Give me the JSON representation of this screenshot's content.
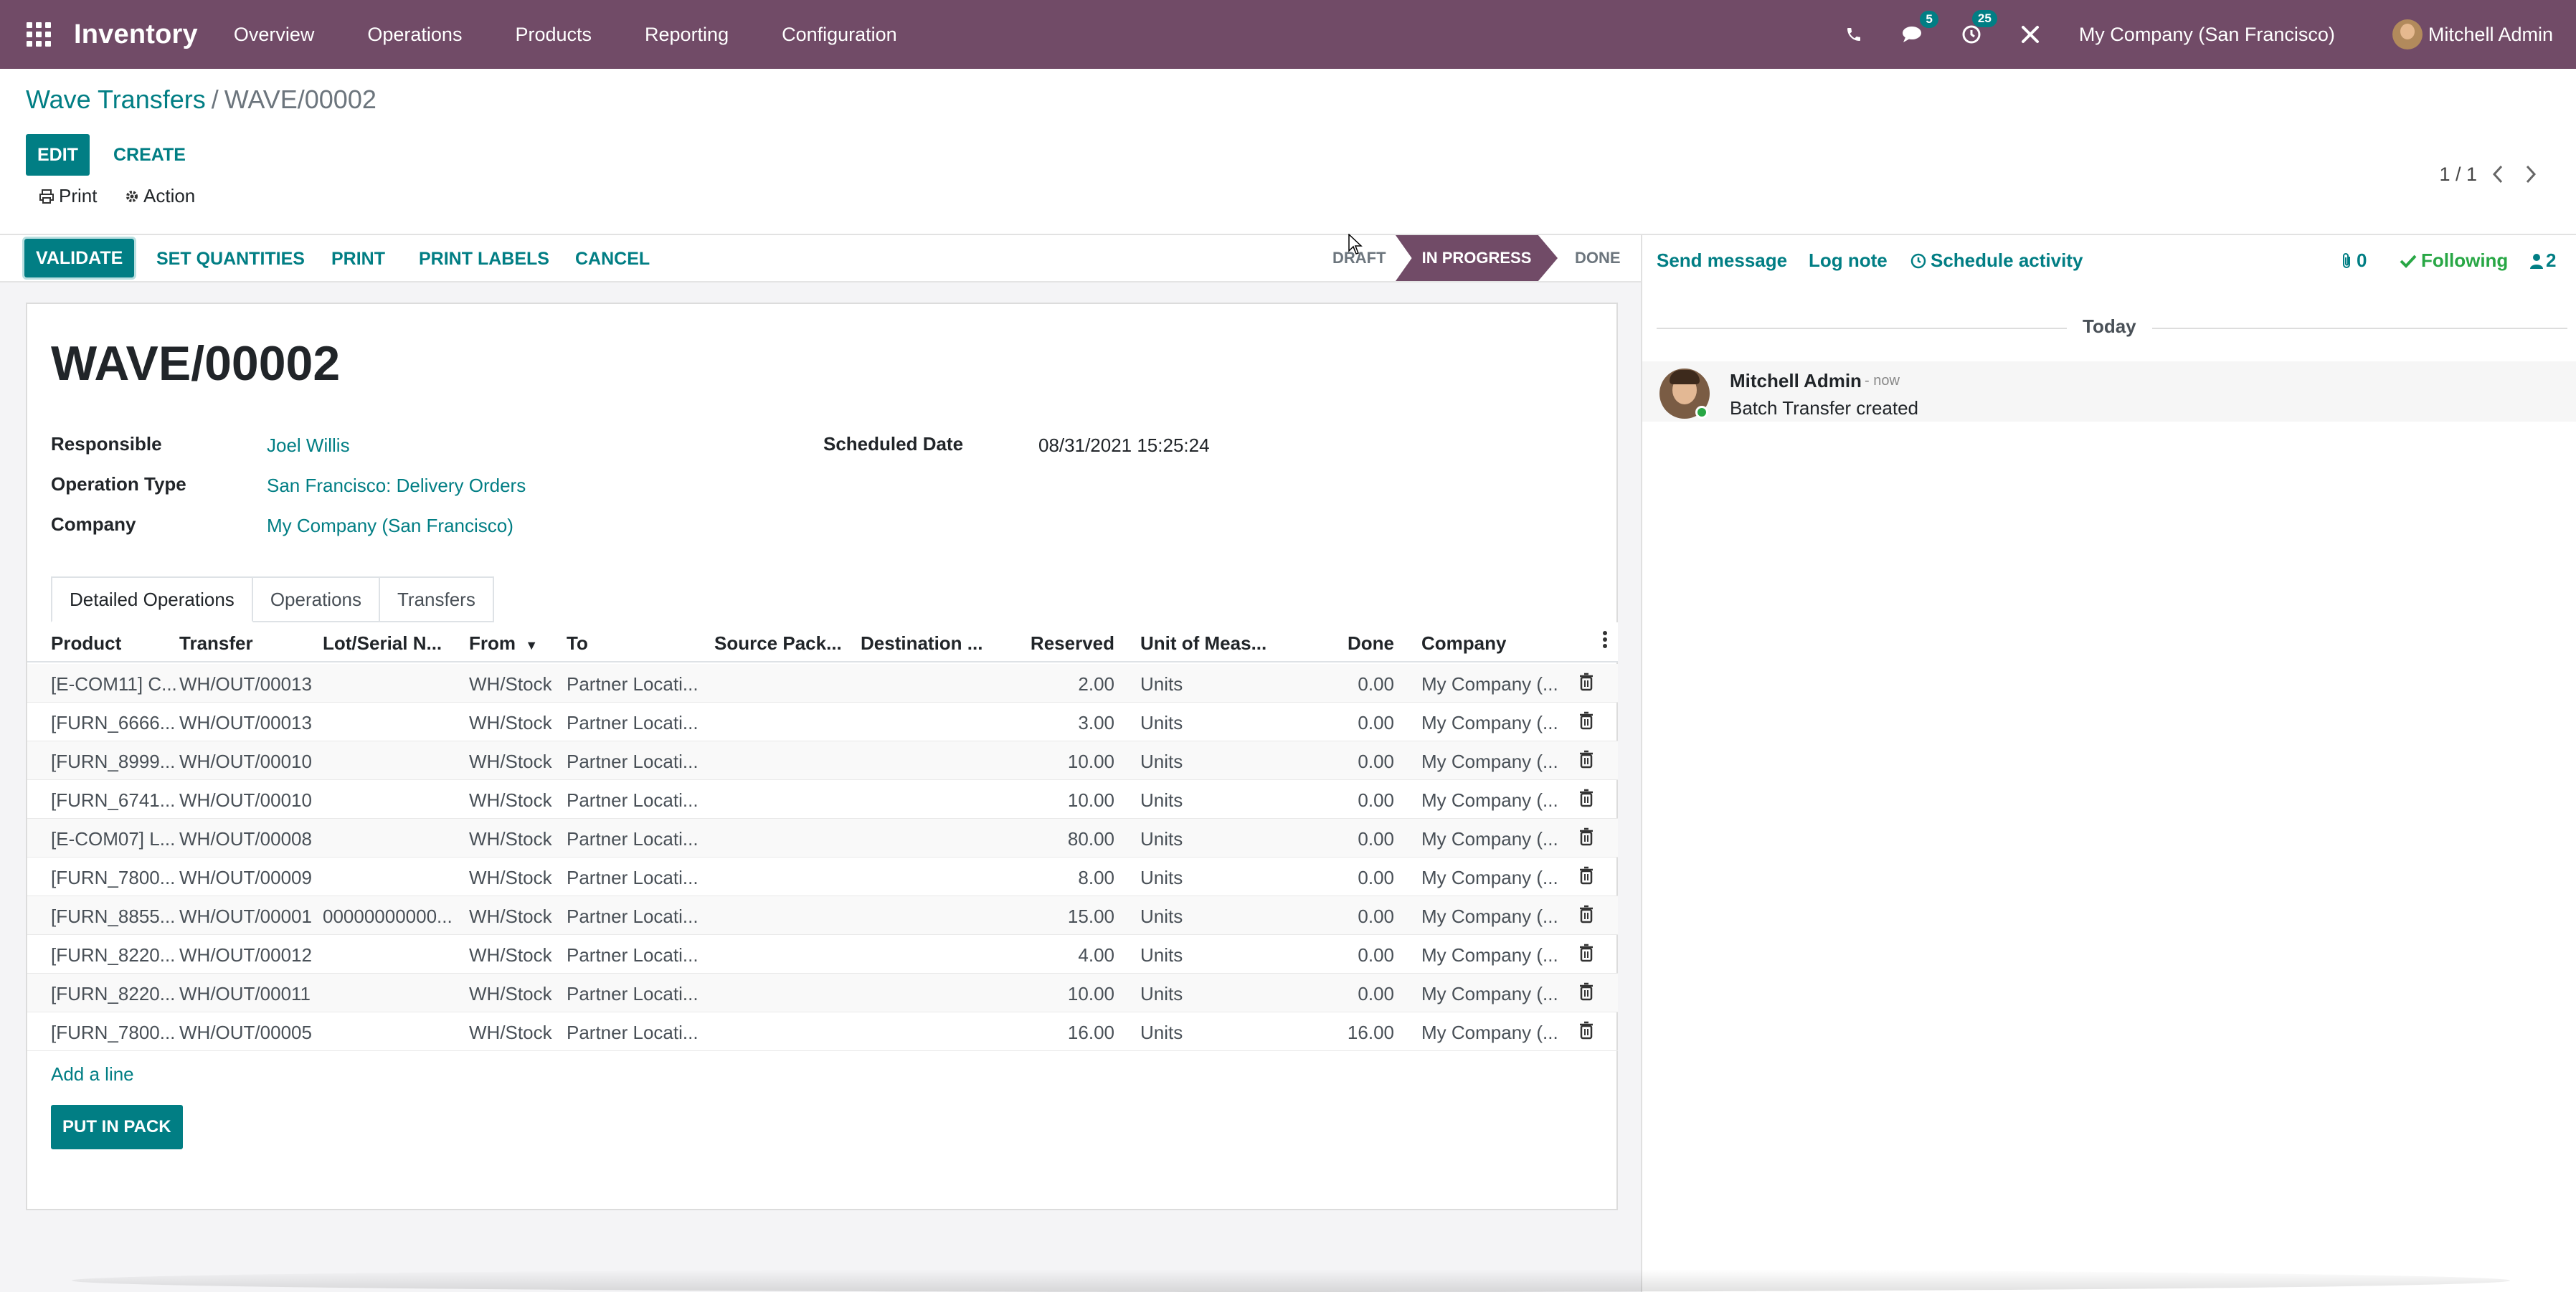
{
  "navbar": {
    "brand": "Inventory",
    "menu": [
      "Overview",
      "Operations",
      "Products",
      "Reporting",
      "Configuration"
    ],
    "messages_badge": "5",
    "activities_badge": "25",
    "company": "My Company (San Francisco)",
    "user": "Mitchell Admin",
    "icons": [
      "apps-grid-icon",
      "phone-icon",
      "chat-icon",
      "clock-icon",
      "debug-tools-icon"
    ]
  },
  "breadcrumb": {
    "parent": "Wave Transfers",
    "separator": "/",
    "current": "WAVE/00002"
  },
  "control_panel": {
    "edit_label": "EDIT",
    "create_label": "CREATE",
    "print_label": "Print",
    "action_label": "Action",
    "pager": "1 / 1"
  },
  "statusbar": {
    "validate_label": "VALIDATE",
    "set_quantities_label": "SET QUANTITIES",
    "print_label": "PRINT",
    "print_labels_label": "PRINT LABELS",
    "cancel_label": "CANCEL",
    "stages": {
      "draft": "DRAFT",
      "in_progress": "IN PROGRESS",
      "done": "DONE"
    },
    "active_stage": "IN PROGRESS"
  },
  "form": {
    "title": "WAVE/00002",
    "responsible_label": "Responsible",
    "responsible_value": "Joel Willis",
    "operation_type_label": "Operation Type",
    "operation_type_value": "San Francisco: Delivery Orders",
    "company_label": "Company",
    "company_value": "My Company (San Francisco)",
    "scheduled_date_label": "Scheduled Date",
    "scheduled_date_value": "08/31/2021 15:25:24"
  },
  "tabs": [
    "Detailed Operations",
    "Operations",
    "Transfers"
  ],
  "grid": {
    "headers": {
      "product": "Product",
      "transfer": "Transfer",
      "lot": "Lot/Serial N...",
      "from": "From",
      "to": "To",
      "source_pack": "Source Pack...",
      "dest": "Destination ...",
      "reserved": "Reserved",
      "uom": "Unit of Meas...",
      "done": "Done",
      "company": "Company"
    },
    "rows": [
      {
        "product": "[E-COM11] C...",
        "transfer": "WH/OUT/00013",
        "lot": "",
        "from": "WH/Stock",
        "to": "Partner Locati...",
        "reserved": "2.00",
        "uom": "Units",
        "done": "0.00",
        "company": "My Company (..."
      },
      {
        "product": "[FURN_6666...",
        "transfer": "WH/OUT/00013",
        "lot": "",
        "from": "WH/Stock",
        "to": "Partner Locati...",
        "reserved": "3.00",
        "uom": "Units",
        "done": "0.00",
        "company": "My Company (..."
      },
      {
        "product": "[FURN_8999...",
        "transfer": "WH/OUT/00010",
        "lot": "",
        "from": "WH/Stock",
        "to": "Partner Locati...",
        "reserved": "10.00",
        "uom": "Units",
        "done": "0.00",
        "company": "My Company (..."
      },
      {
        "product": "[FURN_6741...",
        "transfer": "WH/OUT/00010",
        "lot": "",
        "from": "WH/Stock",
        "to": "Partner Locati...",
        "reserved": "10.00",
        "uom": "Units",
        "done": "0.00",
        "company": "My Company (..."
      },
      {
        "product": "[E-COM07] L...",
        "transfer": "WH/OUT/00008",
        "lot": "",
        "from": "WH/Stock",
        "to": "Partner Locati...",
        "reserved": "80.00",
        "uom": "Units",
        "done": "0.00",
        "company": "My Company (..."
      },
      {
        "product": "[FURN_7800...",
        "transfer": "WH/OUT/00009",
        "lot": "",
        "from": "WH/Stock",
        "to": "Partner Locati...",
        "reserved": "8.00",
        "uom": "Units",
        "done": "0.00",
        "company": "My Company (..."
      },
      {
        "product": "[FURN_8855...",
        "transfer": "WH/OUT/00001",
        "lot": "00000000000...",
        "from": "WH/Stock",
        "to": "Partner Locati...",
        "reserved": "15.00",
        "uom": "Units",
        "done": "0.00",
        "company": "My Company (..."
      },
      {
        "product": "[FURN_8220...",
        "transfer": "WH/OUT/00012",
        "lot": "",
        "from": "WH/Stock",
        "to": "Partner Locati...",
        "reserved": "4.00",
        "uom": "Units",
        "done": "0.00",
        "company": "My Company (..."
      },
      {
        "product": "[FURN_8220...",
        "transfer": "WH/OUT/00011",
        "lot": "",
        "from": "WH/Stock",
        "to": "Partner Locati...",
        "reserved": "10.00",
        "uom": "Units",
        "done": "0.00",
        "company": "My Company (..."
      },
      {
        "product": "[FURN_7800...",
        "transfer": "WH/OUT/00005",
        "lot": "",
        "from": "WH/Stock",
        "to": "Partner Locati...",
        "reserved": "16.00",
        "uom": "Units",
        "done": "16.00",
        "company": "My Company (..."
      }
    ],
    "add_line_label": "Add a line",
    "put_in_pack_label": "PUT IN PACK"
  },
  "chatter": {
    "send_message_label": "Send message",
    "log_note_label": "Log note",
    "schedule_activity_label": "Schedule activity",
    "attachments_count": "0",
    "following_label": "Following",
    "followers_count": "2",
    "date_separator": "Today",
    "messages": [
      {
        "author": "Mitchell Admin",
        "date": "- now",
        "body": "Batch Transfer created"
      }
    ]
  },
  "colors": {
    "brand": "#714b67",
    "accent": "#017e84",
    "online": "#28a745"
  }
}
